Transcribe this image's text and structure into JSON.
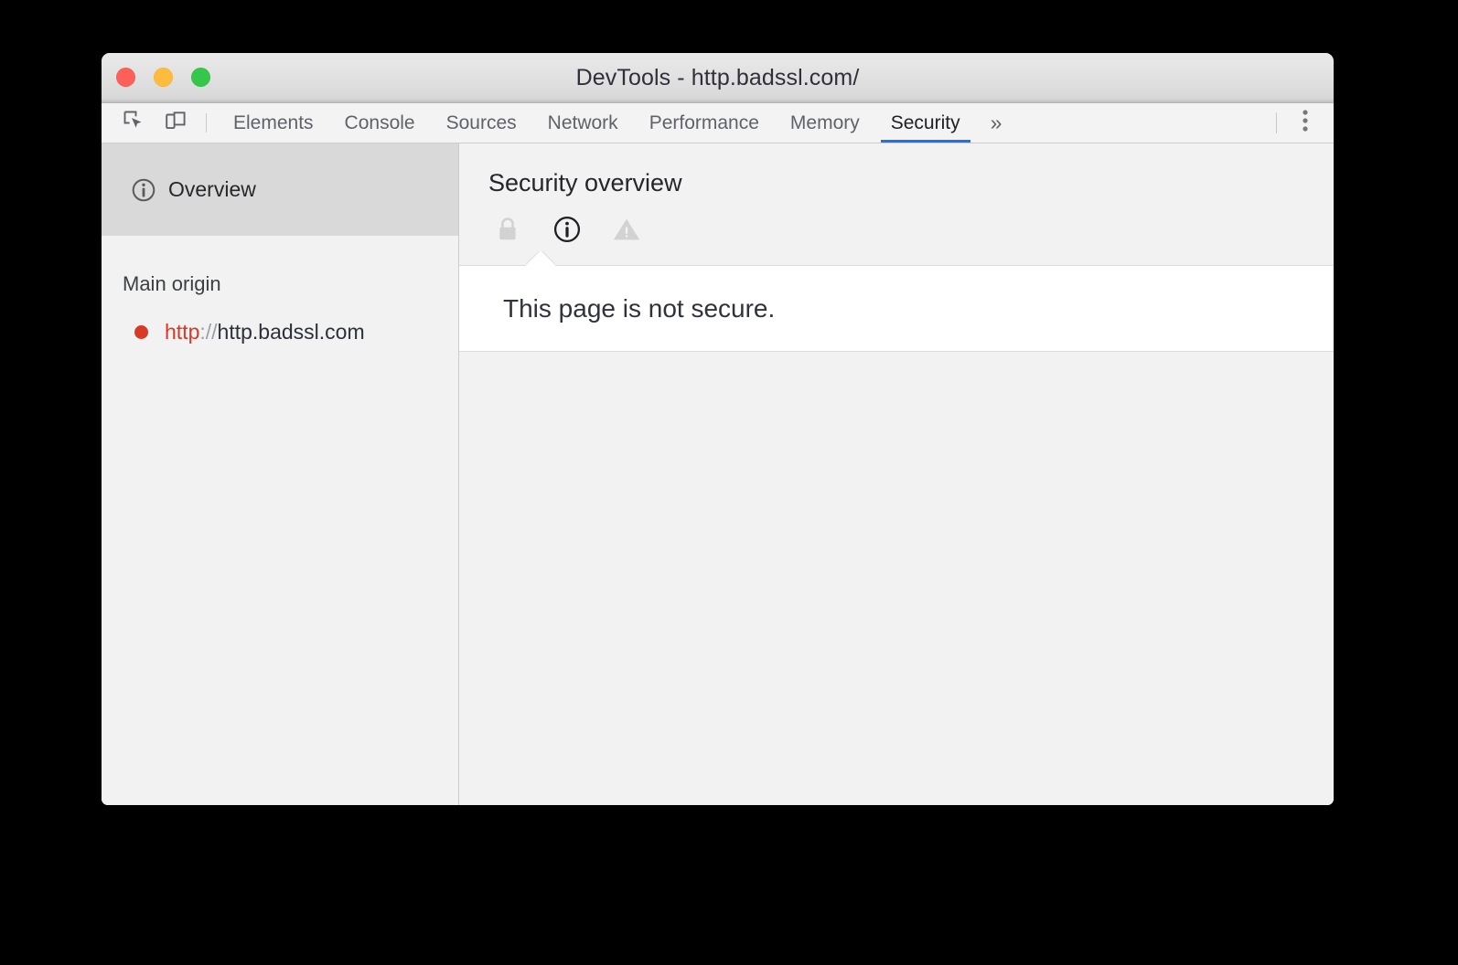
{
  "window": {
    "title": "DevTools - http.badssl.com/",
    "traffic_lights": [
      {
        "name": "close",
        "color": "#fc6058"
      },
      {
        "name": "minimize",
        "color": "#fdbc40"
      },
      {
        "name": "zoom",
        "color": "#34c749"
      }
    ]
  },
  "toolbar": {
    "inspect_icon": "inspect-element-icon",
    "device_icon": "device-toolbar-icon",
    "overflow_label": "»",
    "menu_icon": "more-options-icon",
    "tabs": [
      {
        "label": "Elements",
        "active": false
      },
      {
        "label": "Console",
        "active": false
      },
      {
        "label": "Sources",
        "active": false
      },
      {
        "label": "Network",
        "active": false
      },
      {
        "label": "Performance",
        "active": false
      },
      {
        "label": "Memory",
        "active": false
      },
      {
        "label": "Security",
        "active": true
      }
    ],
    "active_tab": "Security",
    "accent_color": "#1a73e8"
  },
  "sidebar": {
    "overview": {
      "label": "Overview",
      "icon": "info-circle-icon",
      "selected": true
    },
    "group_title": "Main origin",
    "origins": [
      {
        "status_color": "#d93a25",
        "scheme": "http",
        "separator": "://",
        "host": "http.badssl.com",
        "full": "http://http.badssl.com"
      }
    ]
  },
  "main": {
    "title": "Security overview",
    "state_icons": [
      {
        "name": "lock-icon",
        "state": "inactive"
      },
      {
        "name": "info-circle-icon",
        "state": "active"
      },
      {
        "name": "warning-triangle-icon",
        "state": "inactive"
      }
    ],
    "summary": "This page is not secure."
  }
}
